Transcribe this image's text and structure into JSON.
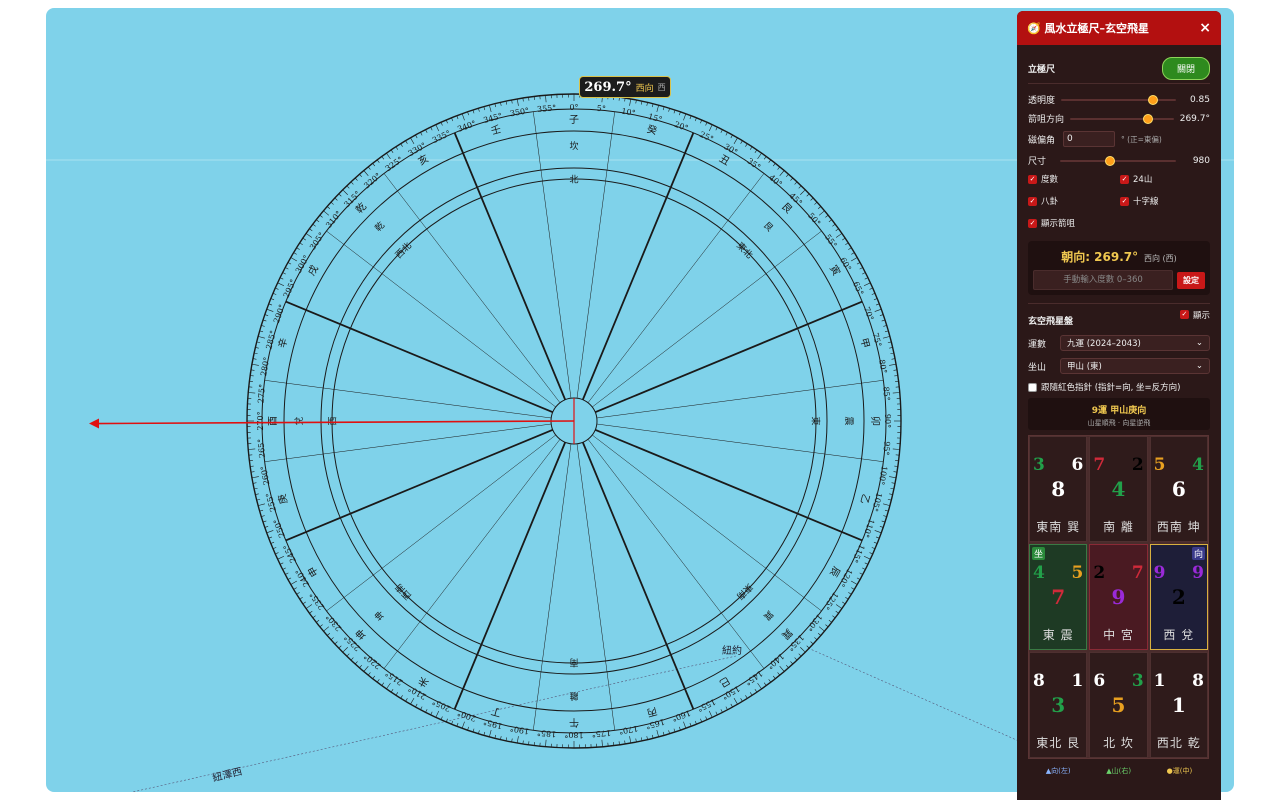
{
  "compass": {
    "heading_deg": 269.7,
    "badge_deg": "269.7°",
    "badge_dir": "西向",
    "badge_dir2": "西",
    "degree_labels": [
      "0°",
      "5°",
      "10°",
      "15°",
      "20°",
      "25°",
      "30°",
      "35°",
      "40°",
      "45°",
      "50°",
      "55°",
      "60°",
      "65°",
      "70°",
      "75°",
      "80°",
      "85°",
      "90°",
      "95°",
      "100°",
      "105°",
      "110°",
      "115°",
      "120°",
      "125°",
      "130°",
      "135°",
      "140°",
      "145°",
      "150°",
      "155°",
      "160°",
      "165°",
      "170°",
      "175°",
      "180°",
      "185°",
      "190°",
      "195°",
      "200°",
      "205°",
      "210°",
      "215°",
      "220°",
      "225°",
      "230°",
      "235°",
      "240°",
      "245°",
      "250°",
      "255°",
      "260°",
      "265°",
      "270°",
      "275°",
      "280°",
      "285°",
      "290°",
      "295°",
      "300°",
      "305°",
      "310°",
      "315°",
      "320°",
      "325°",
      "330°",
      "335°",
      "340°",
      "345°",
      "350°",
      "355°"
    ],
    "mountains": [
      "子",
      "癸",
      "丑",
      "艮",
      "寅",
      "甲",
      "卯",
      "乙",
      "辰",
      "巽",
      "巳",
      "丙",
      "午",
      "丁",
      "未",
      "坤",
      "申",
      "庚",
      "酉",
      "辛",
      "戌",
      "乾",
      "亥",
      "壬"
    ],
    "trigrams": [
      {
        "a": "坎",
        "b": "北"
      },
      {
        "a": "艮",
        "b": "東北"
      },
      {
        "a": "震",
        "b": "東"
      },
      {
        "a": "巽",
        "b": "東南"
      },
      {
        "a": "離",
        "b": "南"
      },
      {
        "a": "坤",
        "b": "西南"
      },
      {
        "a": "兌",
        "b": "西"
      },
      {
        "a": "乾",
        "b": "西北"
      }
    ],
    "colors": {
      "line": "#1a1a1a",
      "needle": "#e01010"
    }
  },
  "map": {
    "label_a": "紐約",
    "label_b": "紐澤西"
  },
  "panel": {
    "title": "風水立極尺–玄空飛星",
    "close": "×",
    "section1": "立極尺",
    "toggle_btn": "關閉",
    "opacity_label": "透明度",
    "opacity_value": "0.85",
    "opacity_frac": 0.8,
    "arrow_label": "箭咀方向",
    "arrow_value": "269.7°",
    "arrow_frac": 0.75,
    "decl_label": "磁偏角",
    "decl_value": "0",
    "decl_hint": "° (正=東偏)",
    "size_label": "尺寸",
    "size_value": "980",
    "size_frac": 0.43,
    "cb_degrees": "度數",
    "cb_24": "24山",
    "cb_bagua": "八卦",
    "cb_cross": "十字線",
    "cb_arrow": "顯示箭咀",
    "facing_title": "朝向: 269.7°",
    "facing_sub": "西向 (西)",
    "manual_placeholder": "手動輸入度數 0–360",
    "set_btn": "設定",
    "section2": "玄空飛星盤",
    "show_label": "顯示",
    "period_label": "運數",
    "period_value": "九運 (2024–2043)",
    "sit_label": "坐山",
    "sit_value": "甲山 (東)",
    "follow_label": "跟隨紅色指針 (指針=向, 坐=反方向)",
    "chart_title": "9運 甲山庚向",
    "chart_sub": "山星順飛 · 向星逆飛",
    "legend_facing": "▲向(左)",
    "legend_mountain": "▲山(右)",
    "legend_period": "●運(中)",
    "tag_sit": "坐",
    "tag_face": "向",
    "palaces": [
      {
        "name": "東南 巽",
        "l": "3",
        "r": "6",
        "c": "8",
        "lc": "#22a04a",
        "rc": "#ffffff",
        "cc": "#ffffff",
        "bg": "#2f1b1b"
      },
      {
        "name": "南 離",
        "l": "7",
        "r": "2",
        "c": "4",
        "lc": "#d02a3a",
        "rc": "#000000",
        "cc": "#22a04a",
        "bg": "#2f1b1b"
      },
      {
        "name": "西南 坤",
        "l": "5",
        "r": "4",
        "c": "6",
        "lc": "#e8a020",
        "rc": "#22a04a",
        "cc": "#ffffff",
        "bg": "#2f1b1b"
      },
      {
        "name": "東 震",
        "l": "4",
        "r": "5",
        "c": "7",
        "lc": "#22a04a",
        "rc": "#e8a020",
        "cc": "#d02a3a",
        "bg": "#1e3a24"
      },
      {
        "name": "中 宮",
        "l": "2",
        "r": "7",
        "c": "9",
        "lc": "#000000",
        "rc": "#d02a3a",
        "cc": "#9a2ad8",
        "bg": "#4a1a22"
      },
      {
        "name": "西 兌",
        "l": "9",
        "r": "9",
        "c": "2",
        "lc": "#9a2ad8",
        "rc": "#9a2ad8",
        "cc": "#000000",
        "bg": "#1e1e38"
      },
      {
        "name": "東北 艮",
        "l": "8",
        "r": "1",
        "c": "3",
        "lc": "#ffffff",
        "rc": "#ffffff",
        "cc": "#22a04a",
        "bg": "#2f1b1b"
      },
      {
        "name": "北 坎",
        "l": "6",
        "r": "3",
        "c": "5",
        "lc": "#ffffff",
        "rc": "#22a04a",
        "cc": "#e8a020",
        "bg": "#2f1b1b"
      },
      {
        "name": "西北 乾",
        "l": "1",
        "r": "8",
        "c": "1",
        "lc": "#ffffff",
        "rc": "#ffffff",
        "cc": "#ffffff",
        "bg": "#2f1b1b"
      }
    ]
  }
}
